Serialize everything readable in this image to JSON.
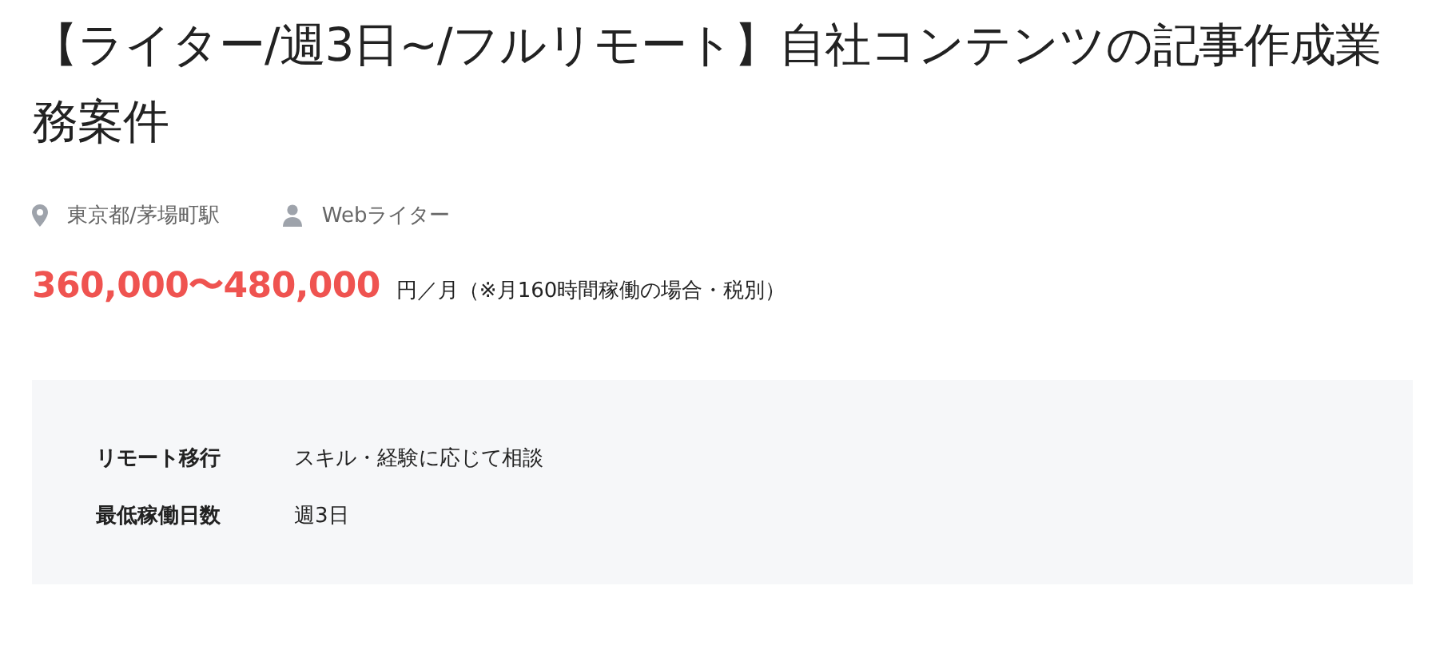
{
  "title": "【ライター/週3日~/フルリモート】自社コンテンツの記事作成業務案件",
  "meta": [
    {
      "kind": "location",
      "text": "東京都/茅場町駅"
    },
    {
      "kind": "role",
      "text": "Webライター"
    }
  ],
  "salary": {
    "amount": "360,000〜480,000",
    "note": "円／月（※月160時間稼働の場合・税別）"
  },
  "details": [
    {
      "label": "リモート移行",
      "value": "スキル・経験に応じて相談"
    },
    {
      "label": "最低稼働日数",
      "value": "週3日"
    }
  ]
}
